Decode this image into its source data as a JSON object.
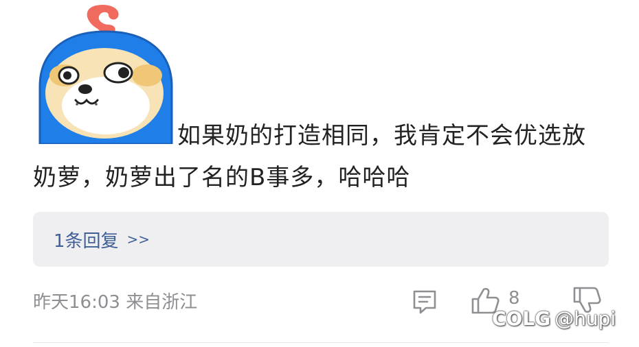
{
  "comment": {
    "text": "如果奶的打造相同，我肯定不会优选放奶萝，奶萝出了名的B事多，哈哈哈"
  },
  "reply": {
    "label": "1条回复",
    "arrow": ">>"
  },
  "meta": {
    "time_location": "昨天16:03 来自浙江"
  },
  "actions": {
    "like_count": "8",
    "icons": [
      "comment-icon",
      "thumbs-up-icon",
      "thumbs-down-icon"
    ]
  },
  "watermark": {
    "logo": "COLG",
    "handle": "@hupi"
  },
  "colors": {
    "reply_link": "#3f5f96",
    "meta_text": "#8e8e93",
    "reply_bg": "#efeff1",
    "sticker_blue": "#1f7ee8"
  }
}
